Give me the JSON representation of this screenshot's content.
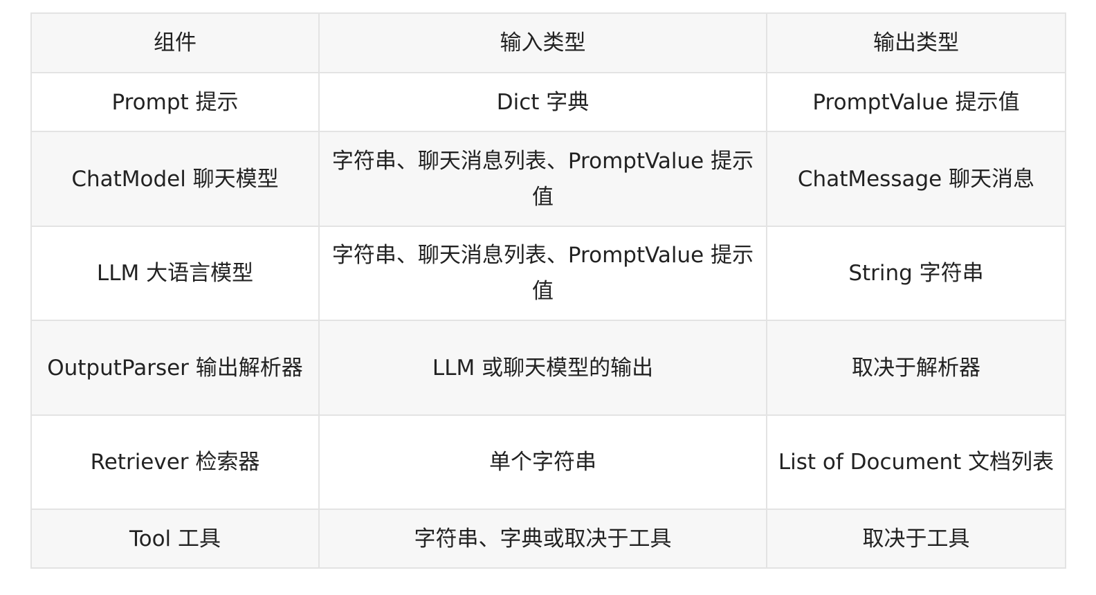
{
  "table": {
    "headers": [
      "组件",
      "输入类型",
      "输出类型"
    ],
    "rows": [
      [
        "Prompt 提示",
        "Dict 字典",
        "PromptValue 提示值"
      ],
      [
        "ChatModel 聊天模型",
        "字符串、聊天消息列表、PromptValue 提示值",
        "ChatMessage 聊天消息"
      ],
      [
        "LLM 大语言模型",
        "字符串、聊天消息列表、PromptValue 提示值",
        "String 字符串"
      ],
      [
        "OutputParser 输出解析器",
        "LLM 或聊天模型的输出",
        "取决于解析器"
      ],
      [
        "Retriever 检索器",
        "单个字符串",
        "List of Document 文档列表"
      ],
      [
        "Tool 工具",
        "字符串、字典或取决于工具",
        "取决于工具"
      ]
    ]
  }
}
